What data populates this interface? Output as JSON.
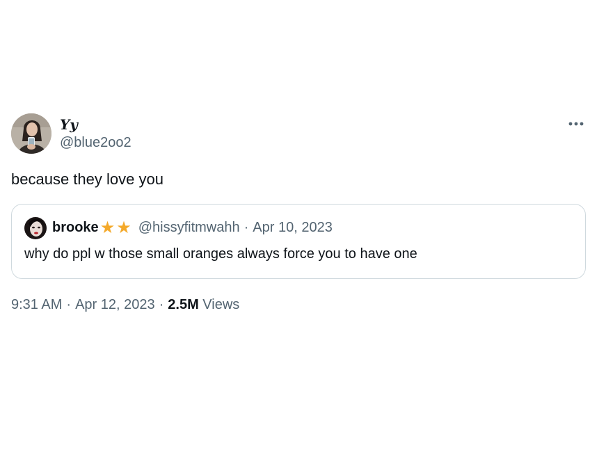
{
  "tweet": {
    "author": {
      "display_name": "Yy",
      "handle": "@blue2oo2"
    },
    "text": "because they love you",
    "more_icon": "more-horizontal-icon",
    "quote": {
      "author_name": "brooke",
      "badges": [
        "★",
        "★"
      ],
      "badge_color": "#f4a92a",
      "handle": "@hissyfitmwahh",
      "separator": "·",
      "date": "Apr 10, 2023",
      "text": "why do ppl w those small oranges always force you to have one"
    },
    "meta": {
      "time": "9:31 AM",
      "separator": "·",
      "date": "Apr 12, 2023",
      "views_count": "2.5M",
      "views_label": "Views"
    }
  },
  "colors": {
    "text_primary": "#0f1419",
    "text_secondary": "#536471",
    "border": "#cfd9de",
    "background": "#ffffff"
  }
}
